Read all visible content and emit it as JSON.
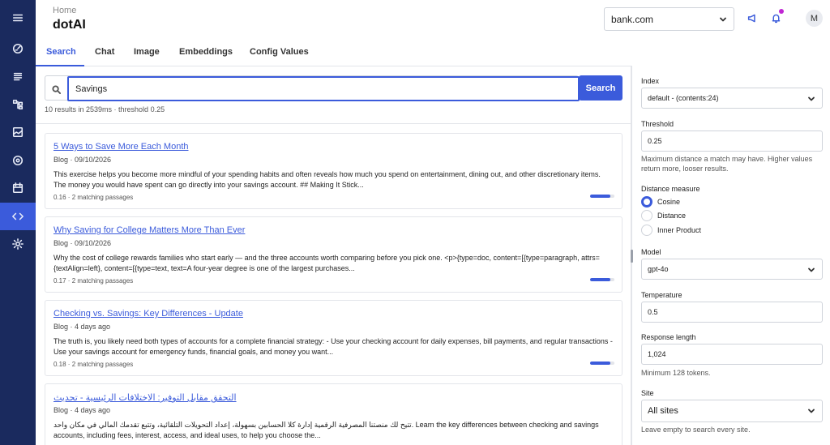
{
  "header": {
    "breadcrumb": "Home",
    "title": "dotAI",
    "site": "bank.com",
    "avatar_initial": "M"
  },
  "rail": {
    "icons": [
      "menu-icon",
      "analytics-icon",
      "content-icon",
      "structure-icon",
      "media-icon",
      "marketing-icon",
      "calendar-icon",
      "dev-tools-icon",
      "settings-icon"
    ],
    "active": "dev-tools-icon"
  },
  "tabs": [
    {
      "label": "Search",
      "active": true
    },
    {
      "label": "Chat",
      "active": false
    },
    {
      "label": "Image",
      "active": false
    },
    {
      "label": "Embeddings",
      "active": false
    },
    {
      "label": "Config Values",
      "active": false
    }
  ],
  "search": {
    "value": "Savings",
    "button_label": "Search",
    "meta": "10 results in 2539ms · threshold 0.25"
  },
  "results": [
    {
      "title": "5 Ways to Save More Each Month",
      "sub": "Blog · 09/10/2026",
      "snippet": "This exercise helps you become more mindful of your spending habits and often reveals how much you spend on entertainment, dining out, and other discretionary items. The money you would have spent can go directly into your savings account. ## Making It Stick...",
      "score": "0.16",
      "passages": "2 matching passages",
      "bar_fill": 0.84
    },
    {
      "title": "Why Saving for College Matters More Than Ever",
      "sub": "Blog · 09/10/2026",
      "snippet": "Why the cost of college rewards families who start early — and the three accounts worth comparing before you pick one. <p>{type=doc, content=[{type=paragraph, attrs={textAlign=left}, content=[{type=text, text=A four-year degree is one of the largest purchases...",
      "score": "0.17",
      "passages": "2 matching passages",
      "bar_fill": 0.83
    },
    {
      "title": "Checking vs. Savings: Key Differences - Update",
      "sub": "Blog · 4 days ago",
      "snippet": "The truth is, you likely need both types of accounts for a complete financial strategy: - Use your checking account for daily expenses, bill payments, and regular transactions - Use your savings account for emergency funds, financial goals, and money you want...",
      "score": "0.18",
      "passages": "2 matching passages",
      "bar_fill": 0.82
    },
    {
      "title": "التحقق مقابل التوفير: الاختلافات الرئيسية - تحديث",
      "sub": "Blog · 4 days ago",
      "snippet": "تتيح لك منصتنا المصرفية الرقمية إدارة كلا الحسابين بسهولة، إعداد التحويلات التلقائية، وتتبع تقدمك المالي في مكان واحد. Learn the key differences between checking and savings accounts, including fees, interest, access, and ideal uses, to help you choose the...",
      "score": "",
      "passages": "",
      "bar_fill": 0
    }
  ],
  "panel": {
    "index_label": "Index",
    "index_value": "default - (contents:24)",
    "threshold_label": "Threshold",
    "threshold_value": "0.25",
    "threshold_hint": "Maximum distance a match may have. Higher values return more, looser results.",
    "distance_label": "Distance measure",
    "distance_options": [
      {
        "label": "Cosine",
        "selected": true
      },
      {
        "label": "Distance",
        "selected": false
      },
      {
        "label": "Inner Product",
        "selected": false
      }
    ],
    "model_label": "Model",
    "model_value": "gpt-4o",
    "temperature_label": "Temperature",
    "temperature_value": "0.5",
    "response_label": "Response length",
    "response_value": "1,024",
    "response_hint": "Minimum 128 tokens.",
    "site_label": "Site",
    "site_value": "All sites",
    "site_hint": "Leave empty to search every site."
  },
  "colors": {
    "rail_bg": "#1a2a5e",
    "accent": "#3b5bdb",
    "notification_dot": "#c026d3"
  }
}
